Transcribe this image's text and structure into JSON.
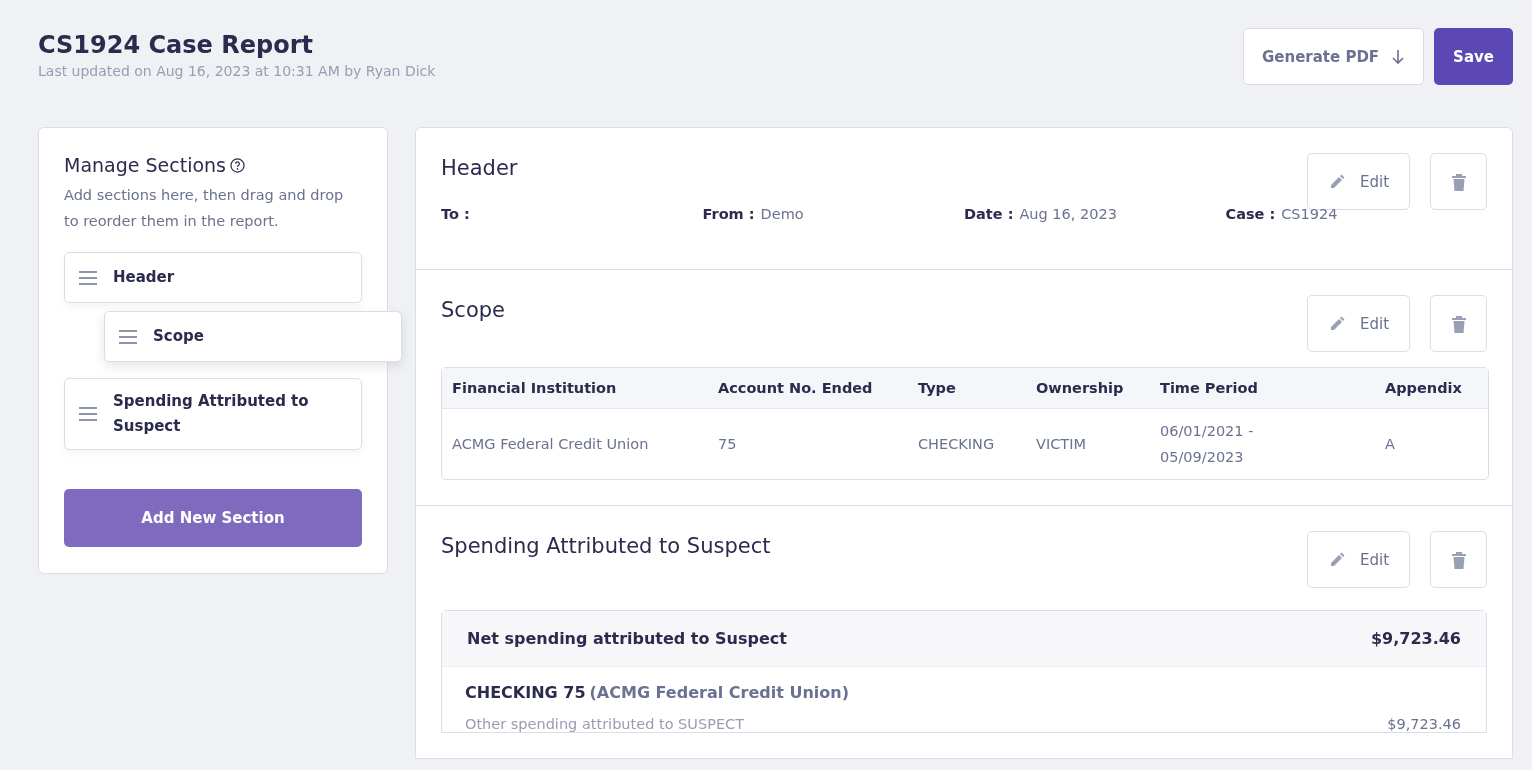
{
  "page": {
    "title": "CS1924 Case Report",
    "subtitle": "Last updated on Aug 16, 2023 at 10:31 AM by Ryan Dick"
  },
  "actions": [
    {
      "label": "Generate PDF",
      "kind": "download"
    },
    {
      "label": "Save",
      "kind": "primary"
    }
  ],
  "sidebar": {
    "title": "Manage Sections",
    "hint": "Add sections here, then drag and drop to reorder them in the report.",
    "items": [
      {
        "label": "Header",
        "dragging": false
      },
      {
        "label": "Scope",
        "dragging": true
      },
      {
        "label": "Spending Attributed to Suspect",
        "dragging": false
      }
    ],
    "add_button": "Add New Section"
  },
  "sections": [
    {
      "title": "Header",
      "kind": "fields",
      "edit": "Edit",
      "fields": [
        {
          "label": "To :"
        },
        {
          "label": "From :",
          "value": "Demo"
        },
        {
          "label": "Date :",
          "value": "Aug 16, 2023"
        },
        {
          "label": "Case :",
          "value": "CS1924"
        }
      ]
    },
    {
      "title": "Scope",
      "kind": "table",
      "edit": "Edit",
      "columns": [
        "Financial Institution",
        "Account No. Ended",
        "Type",
        "Ownership",
        "Time Period",
        "Appendix"
      ],
      "rows": [
        [
          "ACMG Federal Credit Union",
          "75",
          "CHECKING",
          "VICTIM",
          "06/01/2021 - 05/09/2023",
          "A"
        ]
      ]
    },
    {
      "title": "Spending Attributed to Suspect",
      "kind": "summary",
      "edit": "Edit",
      "total_label": "Net spending attributed to Suspect",
      "total": "$9,723.46",
      "accounts": [
        {
          "name": "CHECKING 75",
          "institution": "(ACMG Federal Credit Union)",
          "lines": [
            {
              "label": "Other spending attributed to SUSPECT",
              "amount": "$9,723.46"
            }
          ]
        }
      ]
    }
  ]
}
